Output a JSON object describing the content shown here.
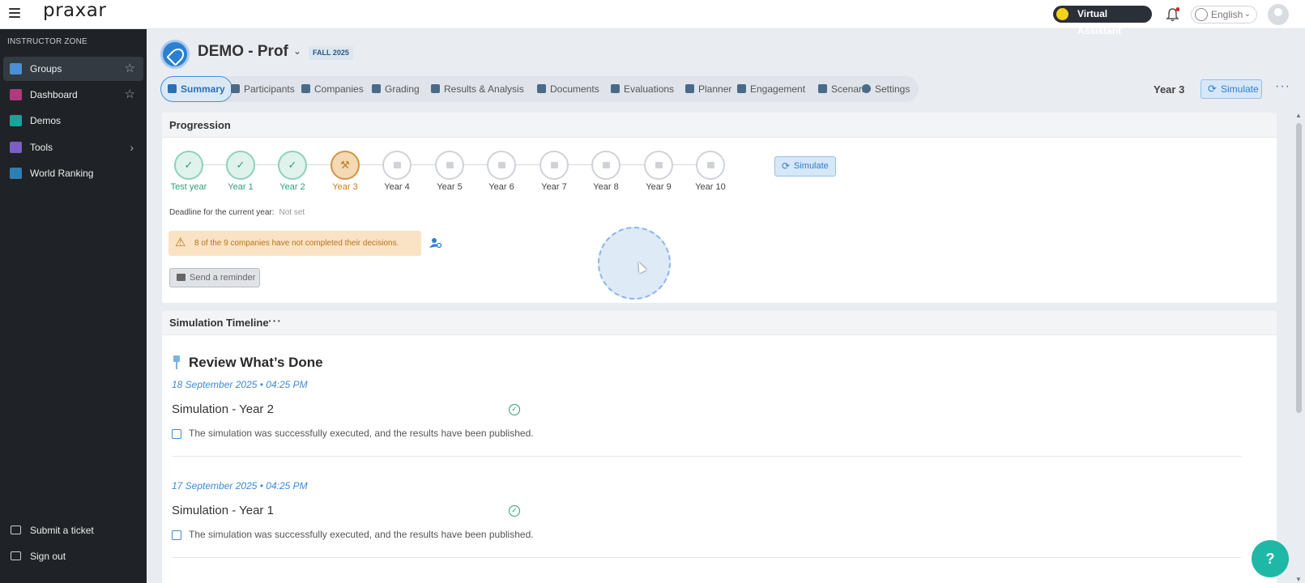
{
  "app": {
    "logo": "praxar",
    "virtual_assistant": "Virtual Assistant",
    "language": "English"
  },
  "sidebar": {
    "zone_label": "INSTRUCTOR ZONE",
    "items": [
      {
        "label": "Groups"
      },
      {
        "label": "Dashboard"
      },
      {
        "label": "Demos"
      },
      {
        "label": "Tools"
      },
      {
        "label": "World Ranking"
      }
    ],
    "bottom": [
      {
        "label": "Submit a ticket"
      },
      {
        "label": "Sign out"
      }
    ]
  },
  "course": {
    "title": "DEMO - Prof",
    "term": "FALL 2025",
    "current_year": "Year 3",
    "simulate_label": "Simulate"
  },
  "tabs": [
    {
      "label": "Summary"
    },
    {
      "label": "Participants"
    },
    {
      "label": "Companies"
    },
    {
      "label": "Grading"
    },
    {
      "label": "Results & Analysis"
    },
    {
      "label": "Documents"
    },
    {
      "label": "Evaluations"
    },
    {
      "label": "Planner"
    },
    {
      "label": "Engagement"
    },
    {
      "label": "Scenario"
    },
    {
      "label": "Settings"
    }
  ],
  "progression": {
    "title": "Progression",
    "steps": [
      {
        "label": "Test year",
        "status": "done"
      },
      {
        "label": "Year 1",
        "status": "done"
      },
      {
        "label": "Year 2",
        "status": "done"
      },
      {
        "label": "Year 3",
        "status": "current"
      },
      {
        "label": "Year 4",
        "status": "pending"
      },
      {
        "label": "Year 5",
        "status": "pending"
      },
      {
        "label": "Year 6",
        "status": "pending"
      },
      {
        "label": "Year 7",
        "status": "pending"
      },
      {
        "label": "Year 8",
        "status": "pending"
      },
      {
        "label": "Year 9",
        "status": "pending"
      },
      {
        "label": "Year 10",
        "status": "pending"
      }
    ],
    "simulate_label": "Simulate",
    "deadline_label": "Deadline for the current year:",
    "deadline_value": "Not set",
    "warning": "8 of the 9 companies have not completed their decisions.",
    "reminder_label": "Send a reminder"
  },
  "timeline": {
    "title": "Simulation Timeline",
    "more": "···",
    "section_title": "Review What’s Done",
    "entries": [
      {
        "date": "18 September 2025 • 04:25 PM",
        "title": "Simulation - Year 2",
        "description": "The simulation was successfully executed, and the results have been published."
      },
      {
        "date": "17 September 2025 • 04:25 PM",
        "title": "Simulation - Year 1",
        "description": "The simulation was successfully executed, and the results have been published."
      }
    ]
  },
  "colors": {
    "accent": "#2d7fd0",
    "done": "#2e9d7a",
    "current": "#c47b1a",
    "sidebar_bg": "#1f2327",
    "help_button": "#1fb8a7"
  }
}
